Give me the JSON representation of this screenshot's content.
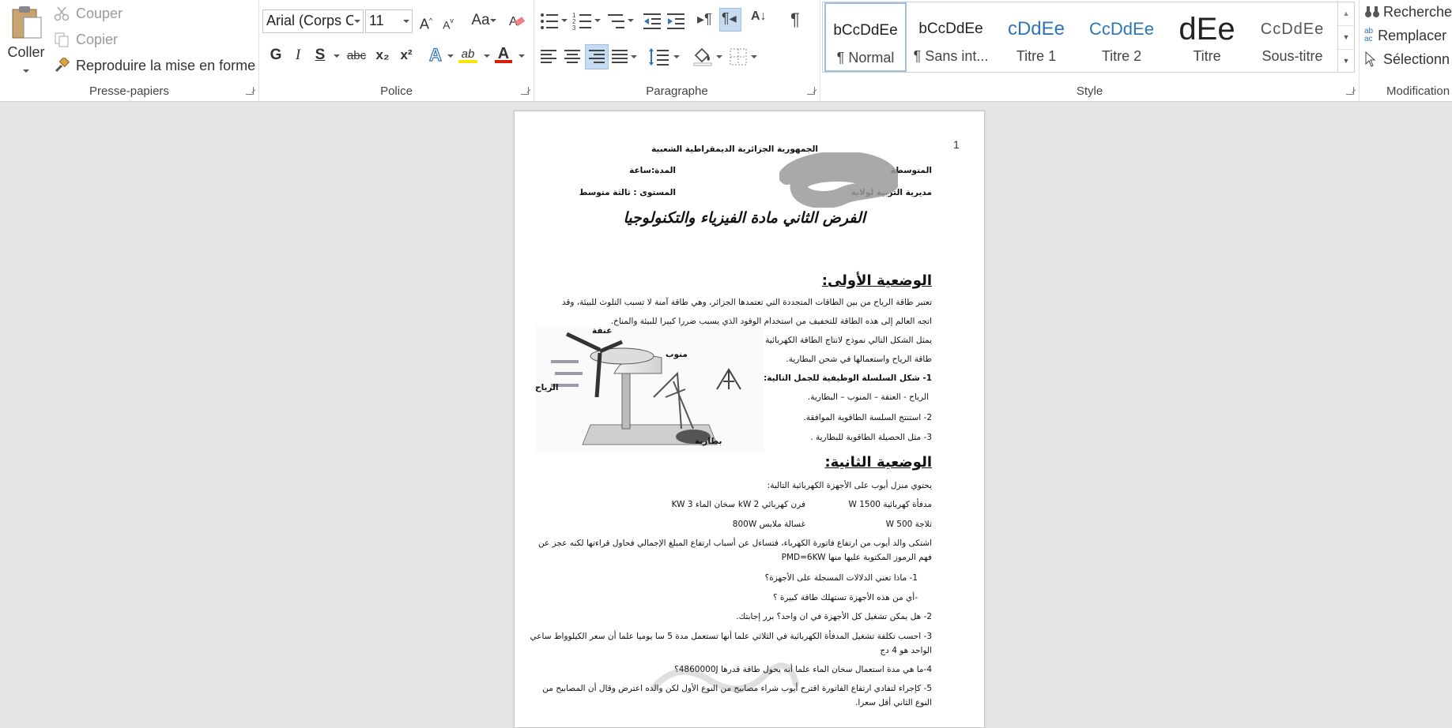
{
  "clipboard": {
    "paste_label": "Coller",
    "cut_label": "Couper",
    "copy_label": "Copier",
    "format_painter_label": "Reproduire la mise en forme",
    "group_label": "Presse-papiers"
  },
  "font": {
    "family_value": "Arial (Corps C",
    "size_value": "11",
    "bold_label": "G",
    "italic_label": "I",
    "underline_label": "S",
    "strike_label": "abc",
    "subscript_label": "x₂",
    "superscript_label": "x²",
    "change_case_label": "Aa",
    "grow_label": "A",
    "shrink_label": "A",
    "effects_label": "A",
    "highlight_label": "ab",
    "color_label": "A",
    "group_label": "Police",
    "highlight_color": "#f6e700",
    "font_color": "#d81e06"
  },
  "paragraph": {
    "group_label": "Paragraphe"
  },
  "styles": {
    "group_label": "Style",
    "items": [
      {
        "preview": "bCcDdEe",
        "name": "¶ Normal"
      },
      {
        "preview": "bCcDdEe",
        "name": "¶ Sans int..."
      },
      {
        "preview": "cDdEe",
        "name": "Titre 1"
      },
      {
        "preview": "CcDdEe",
        "name": "Titre 2"
      },
      {
        "preview": "dEe",
        "name": "Titre"
      },
      {
        "preview": "CcDdEe",
        "name": "Sous-titre"
      }
    ]
  },
  "editing": {
    "find_label": "Rechercher",
    "replace_label": "Remplacer",
    "select_label": "Sélectionn",
    "group_label": "Modification"
  },
  "document": {
    "page_number": "1",
    "header_republic": "الجمهورية الجزائرية الديمقراطية الشعبية",
    "header_school": "المتوسطة",
    "header_duration": "المدة:ساعة",
    "header_directorate": "مديرية التربية لولاية",
    "header_level": "المستوى : ثالثة متوسط",
    "title": "الفرض الثاني مادة الفيزياء والتكنولوجيا",
    "section1_title": "الوضعية الأولى:",
    "s1_line1": "تعتبر طاقة الرياح من بين الطاقات المتجددة التي تعتمدها الجزائر، وهي طاقة آمنة لا تسبب التلوث للبيئة، وقد",
    "s1_line2": "اتجه العالم إلى هذه الطاقة للتخفيف من استخدام الوقود الذي يسبب ضررا كبيرا للبيئة والمناخ.",
    "s1_line3": "يمثل الشكل التالي نموذج لانتاج الطاقة الكهربائية بواسطة",
    "s1_line4": "طاقة الرياح واستعمالها في شحن البطارية.",
    "s1_q1": "1- شكل السلسلة الوظيفية للجمل التالية:",
    "s1_q1_items": "الرياح - العنفة – المنوب – البطارية.",
    "s1_q2": "2- استنتج السلسة الطاقوية الموافقة.",
    "s1_q3": "3- مثل الحصيلة الطاقوية للبطارية .",
    "fig_label_turbine": "عنفة",
    "fig_label_alternator": "منوب",
    "fig_label_wind": "الرياح",
    "fig_label_battery": "بطارية",
    "section2_title": "الوضعية الثانية:",
    "s2_line1": "يحتوي منزل أيوب على الأجهزة الكهربائية التالية:",
    "s2_heater": "مدفأة كهربائية 1500 W",
    "s2_oven": "فرن كهربائي  2 kW",
    "s2_waterheater": "سخان الماء 3 KW",
    "s2_fridge": "ثلاجة 500 W",
    "s2_washer": "غسالة ملابس 800W",
    "s2_para1": "اشتكى والد أيوب من ارتفاع فاتورة الكهرباء، فتساءل عن أسباب ارتفاع المبلغ الإجمالي فحاول قراءتها لكنه عجز عن",
    "s2_para2": "فهم الرموز المكتوبة عليها منها PMD=6KW",
    "s2_q1": "1-  ماذا تعني الدلالات المسجلة على الأجهزة؟",
    "s2_q1b": "-أي من هذه الأجهزة تستهلك طاقة كبيرة ؟",
    "s2_q2": "2- هل يمكن تشغيل كل الأجهزة في ان واحد؟ برر إجابتك.",
    "s2_q3a": "3- احسب تكلفة تشغيل المدفأة الكهربائية في الثلاثي علما أنها تستعمل مدة 5 سا يوميا علما أن سعر الكيلوواط ساعي",
    "s2_q3b": "الواحد هو 4 دج",
    "s2_q4": "4-ما هي مدة استعمال سخان الماء علما أنه يحول طاقة قدرها 4860000J؟",
    "s2_q5a": "5- كإجراء لتفادي ارتفاع الفاتورة اقترح أيوب شراء مصابيح من النوع الأول لكن والده اعترض وقال أن المصابيح من",
    "s2_q5b": "النوع الثاني أقل سعرا."
  }
}
